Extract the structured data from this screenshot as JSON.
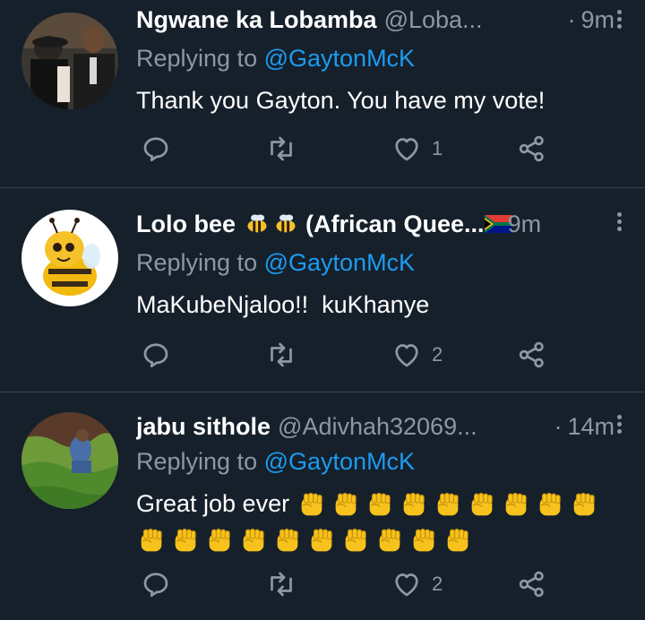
{
  "colors": {
    "background": "#15202b",
    "text": "#ffffff",
    "muted": "#8b98a5",
    "link": "#1d9bf0",
    "divider": "#38444d"
  },
  "tweets": [
    {
      "name": "Ngwane ka Lobamba",
      "handle": "@Loba...",
      "dot": "·",
      "time": "9m",
      "replying_prefix": "Replying to",
      "replying_to": "@GaytonMcK",
      "text": "Thank you Gayton. You have my vote!",
      "replies": "",
      "retweets": "",
      "likes": "1",
      "avatar_icon": "photo-avatar"
    },
    {
      "name": "Lolo bee",
      "name_suffix": "(African Quee...",
      "name_emojis": [
        "bee-emoji",
        "bee-emoji",
        "south-africa-flag-emoji"
      ],
      "handle": "",
      "dot": "",
      "time": "9m",
      "replying_prefix": "Replying to",
      "replying_to": "@GaytonMcK",
      "text": "MaKubeNjaloo!!  kuKhanye",
      "replies": "",
      "retweets": "",
      "likes": "2",
      "avatar_icon": "bee-cartoon-avatar"
    },
    {
      "name": "jabu sithole",
      "handle": "@Adivhah32069...",
      "dot": "·",
      "time": "14m",
      "replying_prefix": "Replying to",
      "replying_to": "@GaytonMcK",
      "text": "Great job ever",
      "fist_emoji_count": 19,
      "replies": "",
      "retweets": "",
      "likes": "2",
      "avatar_icon": "garden-photo-avatar"
    }
  ]
}
